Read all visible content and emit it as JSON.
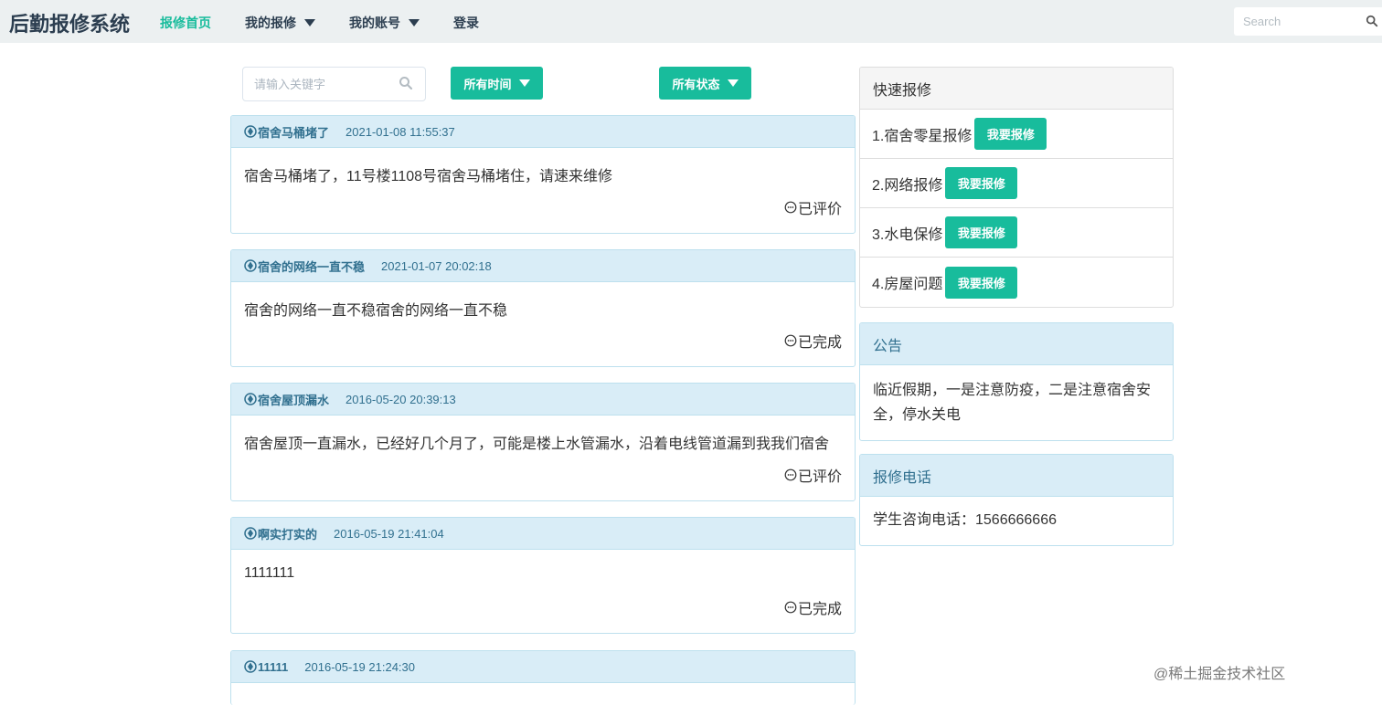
{
  "navbar": {
    "brand": "后勤报修系统",
    "items": [
      {
        "label": "报修首页",
        "active": true,
        "dropdown": false
      },
      {
        "label": "我的报修",
        "active": false,
        "dropdown": true
      },
      {
        "label": "我的账号",
        "active": false,
        "dropdown": true
      },
      {
        "label": "登录",
        "active": false,
        "dropdown": false
      }
    ],
    "search_placeholder": "Search",
    "search_icon": "search-icon"
  },
  "filters": {
    "keyword_placeholder": "请输入关键字",
    "time_label": "所有时间",
    "status_label": "所有状态"
  },
  "repairs": [
    {
      "title": "宿舍马桶堵了",
      "date": "2021-01-08 11:55:37",
      "content": "宿舍马桶堵了，11号楼1108号宿舍马桶堵住，请速来维修",
      "status": "已评价"
    },
    {
      "title": "宿舍的网络一直不稳",
      "date": "2021-01-07 20:02:18",
      "content": "宿舍的网络一直不稳宿舍的网络一直不稳",
      "status": "已完成"
    },
    {
      "title": "宿舍屋顶漏水",
      "date": "2016-05-20 20:39:13",
      "content": "宿舍屋顶一直漏水，已经好几个月了，可能是楼上水管漏水，沿着电线管道漏到我我们宿舍",
      "status": "已评价"
    },
    {
      "title": "啊实打实的",
      "date": "2016-05-19 21:41:04",
      "content": "1111111",
      "status": "已完成"
    },
    {
      "title": "11111",
      "date": "2016-05-19 21:24:30",
      "content": "",
      "status": ""
    }
  ],
  "quick_repair": {
    "title": "快速报修",
    "button_label": "我要报修",
    "items": [
      "1.宿舍零星报修",
      "2.网络报修",
      "3.水电保修",
      "4.房屋问题"
    ]
  },
  "notice": {
    "title": "公告",
    "text": "临近假期，一是注意防疫，二是注意宿舍安全，停水关电"
  },
  "phone": {
    "title": "报修电话",
    "text": "学生咨询电话：1566666666"
  },
  "watermark": "@稀土掘金技术社区",
  "colors": {
    "accent": "#18bc9c",
    "nav_bg": "#ecf0f1",
    "info_bg": "#d9edf7",
    "info_text": "#31708f"
  }
}
